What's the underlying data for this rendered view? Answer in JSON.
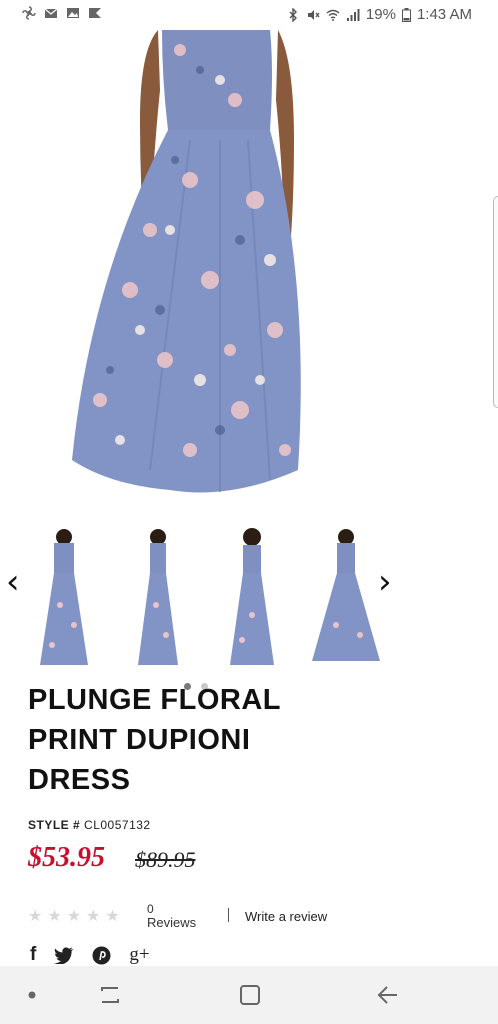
{
  "status_bar": {
    "battery": "19%",
    "time": "1:43 AM"
  },
  "product": {
    "title_line1": "PLUNGE FLORAL",
    "title_line2": "PRINT DUPIONI",
    "title_line3": "DRESS",
    "style_label": "STYLE #",
    "style_code": "CL0057132",
    "price": "$53.95",
    "old_price": "$89.95"
  },
  "reviews": {
    "count": "0",
    "label": "Reviews",
    "write": "Write a review"
  },
  "gallery": {
    "prev_arrow": "chevron-left-icon",
    "next_arrow": "chevron-right-icon",
    "thumbnails": 4,
    "active_dot": 1
  },
  "social": {
    "facebook": "f",
    "twitter": "twitter-icon",
    "pinterest": "pinterest-icon",
    "googleplus": "g+"
  },
  "colors": {
    "dress": "#7f8fc0",
    "price_red": "#c8102e"
  }
}
